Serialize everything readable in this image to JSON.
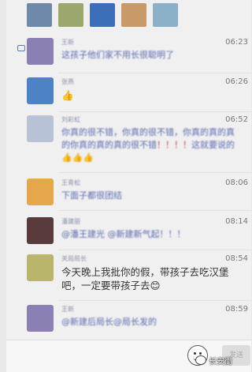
{
  "avatar_colors": [
    "#6e8aa8",
    "#9aa86e",
    "#3d6fb8",
    "#c89a6a",
    "#8bb0c8"
  ],
  "messages": [
    {
      "name": "王新",
      "time": "06:23",
      "text": "这孩子他们家不用长很聪明了",
      "avatar_color": "#8c7fb3"
    },
    {
      "name": "张燕",
      "time": "06:26",
      "text": "👍",
      "avatar_color": "#4d82c4"
    },
    {
      "name": "刘彩虹",
      "time": "06:52",
      "text_parts": [
        "你真的很不错，你真的很不错，你真的真的真的你真的真的真的很不错",
        "！！！！",
        "这就要说的",
        "👍👍👍"
      ],
      "avatar_color": "#b8c2d6"
    },
    {
      "name": "王青松",
      "time": "08:06",
      "text": "下面子都很团结",
      "avatar_color": "#e4a74a"
    },
    {
      "name": "潘建丽",
      "time": "08:14",
      "text": "@潘王建光 @新建新气起！！！",
      "avatar_color": "#5a3b3b"
    },
    {
      "name": "关局局长",
      "time": "08:54",
      "text": "今天晚上我批你的假，带孩子去吃汉堡吧，一定要带孩子去😊",
      "avatar_color": "#b9b56a"
    },
    {
      "name": "王新",
      "time": "08:59",
      "text": "@新建后局长@局长发的",
      "avatar_color": "#8c7fb3"
    }
  ],
  "input_bar": {
    "send_label": "发送"
  },
  "watermark": {
    "text": "长安街"
  }
}
